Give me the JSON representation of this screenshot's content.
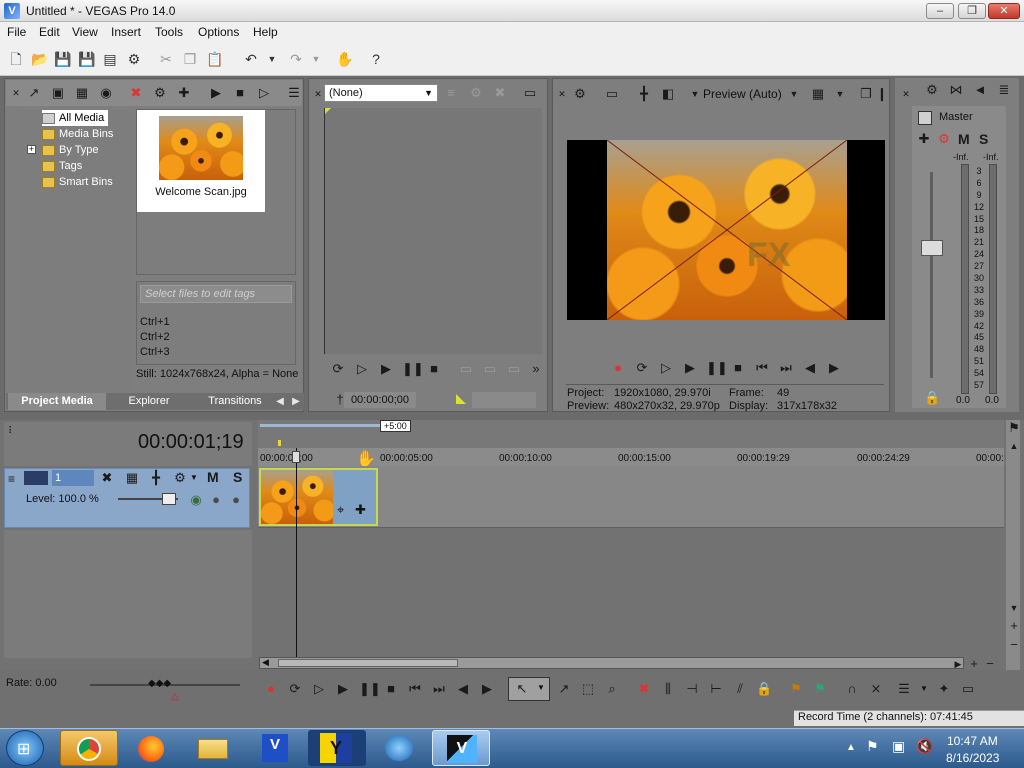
{
  "window": {
    "title": "Untitled * - VEGAS Pro 14.0",
    "app_icon": "V"
  },
  "menu": [
    "File",
    "Edit",
    "View",
    "Insert",
    "Tools",
    "Options",
    "Help"
  ],
  "project_media": {
    "tree": [
      "All Media",
      "Media Bins",
      "By Type",
      "Tags",
      "Smart Bins"
    ],
    "selected_tree_item": "All Media",
    "expand_marker": "+",
    "file_name": "Welcome Scan.jpg",
    "tag_placeholder": "Select files to edit tags",
    "tags": [
      "Ctrl+1",
      "Ctrl+2",
      "Ctrl+3"
    ],
    "file_info": "Still: 1024x768x24, Alpha = None",
    "tabs": [
      "Project Media",
      "Explorer",
      "Transitions"
    ]
  },
  "trimmer": {
    "dropdown_value": "(None)",
    "timecode": "00:00:00;00"
  },
  "preview": {
    "mode_label": "Preview (Auto)",
    "project_label": "Project:",
    "project_value": "1920x1080, 29.970i",
    "preview_label": "Preview:",
    "preview_value": "480x270x32, 29.970p",
    "frame_label": "Frame:",
    "frame_value": "49",
    "display_label": "Display:",
    "display_value": "317x178x32"
  },
  "mixer": {
    "title": "Master",
    "m_label": "M",
    "s_label": "S",
    "inf_left": "-Inf.",
    "inf_right": "-Inf.",
    "scale": [
      "3",
      "6",
      "9",
      "12",
      "15",
      "18",
      "21",
      "24",
      "27",
      "30",
      "33",
      "36",
      "39",
      "42",
      "45",
      "48",
      "51",
      "54",
      "57"
    ],
    "value_left": "0.0",
    "value_right": "0.0"
  },
  "timeline": {
    "timecode": "00:00:01;19",
    "offset_badge": "+5:00",
    "ruler": [
      "00:00:00;00",
      "00:00:05:00",
      "00:00:10:00",
      "00:00:15:00",
      "00:00:19:29",
      "00:00:24:29",
      "00:00:"
    ],
    "track_number": "1",
    "track_level": "Level: 100.0 %",
    "track_m": "M",
    "track_s": "S",
    "rate": "Rate: 0.00",
    "record_time": "Record Time (2 channels): 07:41:45"
  },
  "taskbar": {
    "time": "10:47 AM",
    "date": "8/16/2023"
  }
}
